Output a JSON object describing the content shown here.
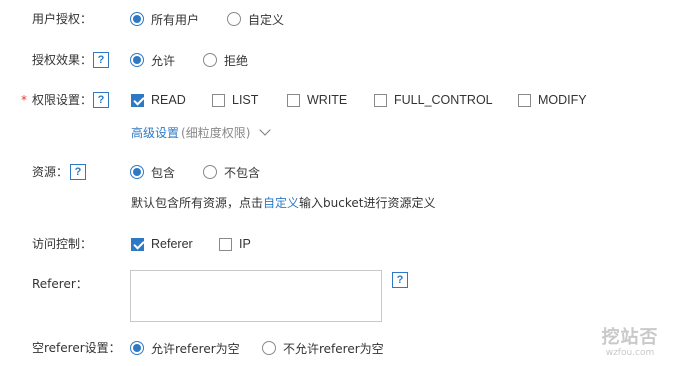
{
  "user_auth": {
    "label": "用户授权：",
    "options": [
      "所有用户",
      "自定义"
    ],
    "selected": 0
  },
  "auth_effect": {
    "label": "授权效果：",
    "options": [
      "允许",
      "拒绝"
    ],
    "selected": 0
  },
  "permissions": {
    "required_mark": "*",
    "label": "权限设置：",
    "items": [
      {
        "label": "READ",
        "checked": true
      },
      {
        "label": "LIST",
        "checked": false
      },
      {
        "label": "WRITE",
        "checked": false
      },
      {
        "label": "FULL_CONTROL",
        "checked": false
      },
      {
        "label": "MODIFY",
        "checked": false
      }
    ],
    "advanced_link": "高级设置",
    "advanced_sub": "(细粒度权限)"
  },
  "resource": {
    "label": "资源：",
    "options": [
      "包含",
      "不包含"
    ],
    "selected": 0,
    "hint_pre": "默认包含所有资源，点击",
    "hint_link": "自定义",
    "hint_post": "输入bucket进行资源定义"
  },
  "access_control": {
    "label": "访问控制：",
    "items": [
      {
        "label": "Referer",
        "checked": true
      },
      {
        "label": "IP",
        "checked": false
      }
    ]
  },
  "referer": {
    "label": "Referer：",
    "value": ""
  },
  "empty_referer": {
    "label": "空referer设置：",
    "options": [
      "允许referer为空",
      "不允许referer为空"
    ],
    "selected": 0
  },
  "help_mark": "?",
  "watermark": {
    "main": "挖站否",
    "sub": "wzfou.com"
  },
  "colors": {
    "accent": "#2e79c6",
    "required": "#e53935",
    "text": "#333333"
  }
}
